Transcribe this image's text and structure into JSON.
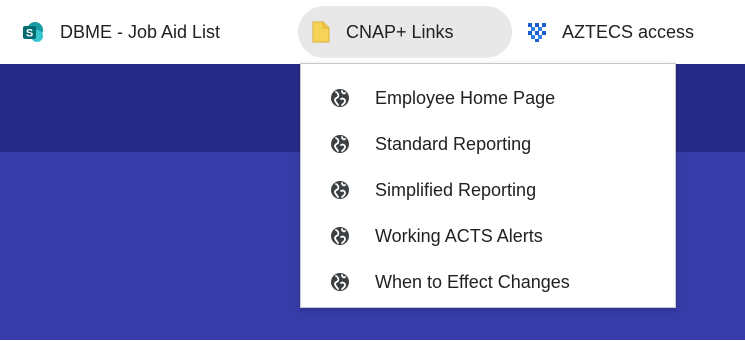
{
  "bookmarks_bar": {
    "items": [
      {
        "label": "DBME - Job Aid List",
        "icon": "sharepoint-icon"
      },
      {
        "label": "CNAP+ Links",
        "icon": "folder-icon"
      },
      {
        "label": "AZTECS access",
        "icon": "aztecs-icon"
      }
    ]
  },
  "dropdown": {
    "items": [
      {
        "label": "Employee Home Page",
        "icon": "globe-icon"
      },
      {
        "label": "Standard Reporting",
        "icon": "globe-icon"
      },
      {
        "label": "Simplified Reporting",
        "icon": "globe-icon"
      },
      {
        "label": "Working ACTS Alerts",
        "icon": "globe-icon"
      },
      {
        "label": "When to Effect Changes",
        "icon": "globe-icon"
      }
    ]
  },
  "colors": {
    "page_dark": "#272b88",
    "page_mid": "#373ca8",
    "folder_yellow": "#f7d358",
    "sharepoint_teal": "#036c70",
    "aztecs_blue": "#1b5fd1"
  }
}
